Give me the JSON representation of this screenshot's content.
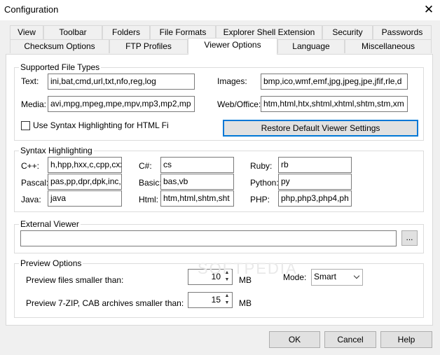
{
  "window": {
    "title": "Configuration",
    "close_glyph": "✕"
  },
  "tabs_row1": [
    "View",
    "Toolbar",
    "Folders",
    "File Formats",
    "Explorer Shell Extension",
    "Security",
    "Passwords"
  ],
  "tabs_row2": [
    "Checksum Options",
    "FTP Profiles",
    "Viewer Options",
    "Language",
    "Miscellaneous"
  ],
  "active_tab": "Viewer Options",
  "supported": {
    "title": "Supported File Types",
    "text_label": "Text:",
    "text_value": "ini,bat,cmd,url,txt,nfo,reg,log",
    "media_label": "Media:",
    "media_value": "avi,mpg,mpeg,mpe,mpv,mp3,mp2,mp",
    "images_label": "Images:",
    "images_value": "bmp,ico,wmf,emf,jpg,jpeg,jpe,jfif,rle,d",
    "web_label": "Web/Office:",
    "web_value": "htm,html,htx,shtml,xhtml,shtm,stm,xm",
    "syntax_check_label": "Use Syntax Highlighting for HTML Fi",
    "restore_button": "Restore Default Viewer Settings"
  },
  "syntax": {
    "title": "Syntax Highlighting",
    "cpp_label": "C++:",
    "cpp_value": "h,hpp,hxx,c,cpp,cxx",
    "csharp_label": "C#:",
    "csharp_value": "cs",
    "ruby_label": "Ruby:",
    "ruby_value": "rb",
    "pascal_label": "Pascal:",
    "pascal_value": "pas,pp,dpr,dpk,inc,",
    "basic_label": "Basic:",
    "basic_value": "bas,vb",
    "python_label": "Python:",
    "python_value": "py",
    "java_label": "Java:",
    "java_value": "java",
    "html_label": "Html:",
    "html_value": "htm,html,shtm,sht",
    "php_label": "PHP:",
    "php_value": "php,php3,php4,ph"
  },
  "external": {
    "title": "External Viewer",
    "value": "",
    "browse": "..."
  },
  "preview": {
    "title": "Preview Options",
    "files_label": "Preview files smaller than:",
    "files_value": "10",
    "files_unit": "MB",
    "archives_label": "Preview 7-ZIP, CAB archives smaller than:",
    "archives_value": "15",
    "archives_unit": "MB",
    "mode_label": "Mode:",
    "mode_value": "Smart"
  },
  "watermark": "SOFTPEDIA",
  "buttons": {
    "ok": "OK",
    "cancel": "Cancel",
    "help": "Help"
  }
}
